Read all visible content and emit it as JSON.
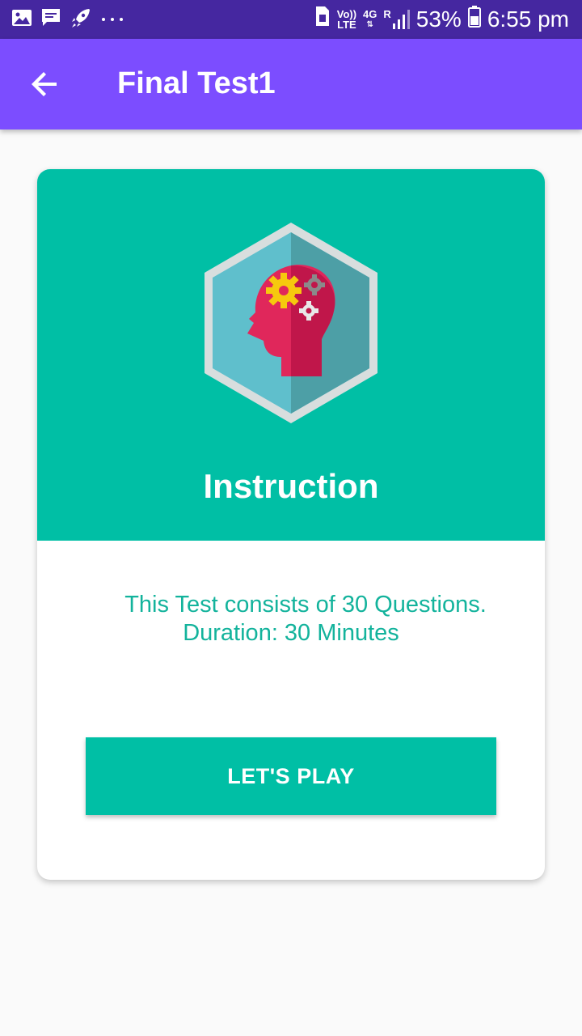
{
  "status_bar": {
    "left_icons": [
      "gallery-icon",
      "message-icon",
      "rocket-icon",
      "more-dots-icon"
    ],
    "volte_top": "Vo))",
    "volte_bottom": "LTE",
    "network_type": "4G",
    "roaming": "R",
    "battery_percent": "53%",
    "time": "6:55 pm"
  },
  "app_bar": {
    "title": "Final Test1",
    "back_icon": "arrow-left-icon",
    "color": "#7c4dff"
  },
  "card": {
    "header_color": "#00bfa5",
    "icon": "brain-gears-hexagon-icon",
    "heading": "Instruction",
    "info_line1": "This Test consists of 30 Questions.",
    "info_line2": "Duration: 30 Minutes",
    "button_label": "LET'S PLAY"
  },
  "colors": {
    "status_bar": "#4527a0",
    "accent": "#00bfa5",
    "info_text": "#13b39c"
  }
}
